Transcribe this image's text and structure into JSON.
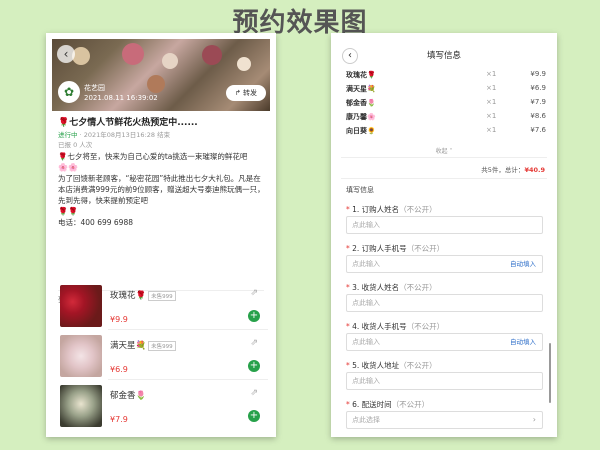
{
  "page_title": "预约效果图",
  "left": {
    "back_glyph": "‹",
    "brand_name": "花艺园",
    "post_time": "2021.08.11 16:39:02",
    "share_label": "转发",
    "event_title": "🌹七夕情人节鲜花火热预定中......",
    "status_tag": "进行中",
    "status_dates": "· 2021年08月13日16:28 结束",
    "joined": "已报 0 人次",
    "desc_lines": [
      "🌹七夕将至，快来为自己心爱的ta挑选一束璀璨的鲜花吧",
      "🌸🌸",
      "为了回馈新老顾客，“秘密花园”特此推出七夕大礼包。凡是在本店消费满999元的前9位顾客，赠送超大号泰迪熊玩偶一只，先到先得，快来提前预定吧",
      "🌹🌹",
      "电话：400 699 6988"
    ],
    "list_header": "列表",
    "items": [
      {
        "name": "玫瑰花🌹",
        "sold": "未售999",
        "price": "¥9.9"
      },
      {
        "name": "满天星💐",
        "sold": "未售999",
        "price": "¥6.9"
      },
      {
        "name": "郁金香🌷",
        "sold": "",
        "price": "¥7.9"
      }
    ],
    "link_glyph": "⇗",
    "add_glyph": "+"
  },
  "right": {
    "back_glyph": "‹",
    "title": "填写信息",
    "orders": [
      {
        "name": "玫瑰花🌹",
        "qty": "×1",
        "price": "¥9.9"
      },
      {
        "name": "满天星💐",
        "qty": "×1",
        "price": "¥6.9"
      },
      {
        "name": "郁金香🌷",
        "qty": "×1",
        "price": "¥7.9"
      },
      {
        "name": "康乃馨🌸",
        "qty": "×1",
        "price": "¥8.6"
      },
      {
        "name": "向日葵🌻",
        "qty": "×1",
        "price": "¥7.6"
      }
    ],
    "collapse_label": "收起",
    "summary_prefix": "共5件，总计：",
    "summary_total": "¥40.9",
    "section_label": "填写信息",
    "fields": [
      {
        "label": "1. 订购人姓名",
        "hint": "（不公开）",
        "placeholder": "点此输入",
        "auto": "",
        "arrow": ""
      },
      {
        "label": "2. 订购人手机号",
        "hint": "（不公开）",
        "placeholder": "点此输入",
        "auto": "自动填入",
        "arrow": ""
      },
      {
        "label": "3. 收货人姓名",
        "hint": "（不公开）",
        "placeholder": "点此输入",
        "auto": "",
        "arrow": ""
      },
      {
        "label": "4. 收货人手机号",
        "hint": "（不公开）",
        "placeholder": "点此输入",
        "auto": "自动填入",
        "arrow": ""
      },
      {
        "label": "5. 收货人地址",
        "hint": "（不公开）",
        "placeholder": "点此输入",
        "auto": "",
        "arrow": ""
      },
      {
        "label": "6. 配送时间",
        "hint": "（不公开）",
        "placeholder": "点此选择",
        "auto": "",
        "arrow": "›"
      }
    ],
    "req_mark": "*"
  },
  "colors": {
    "background": "#d5efbf",
    "accent_green": "#27a14a",
    "price_red": "#e53935",
    "link_blue": "#2d6ec9"
  }
}
